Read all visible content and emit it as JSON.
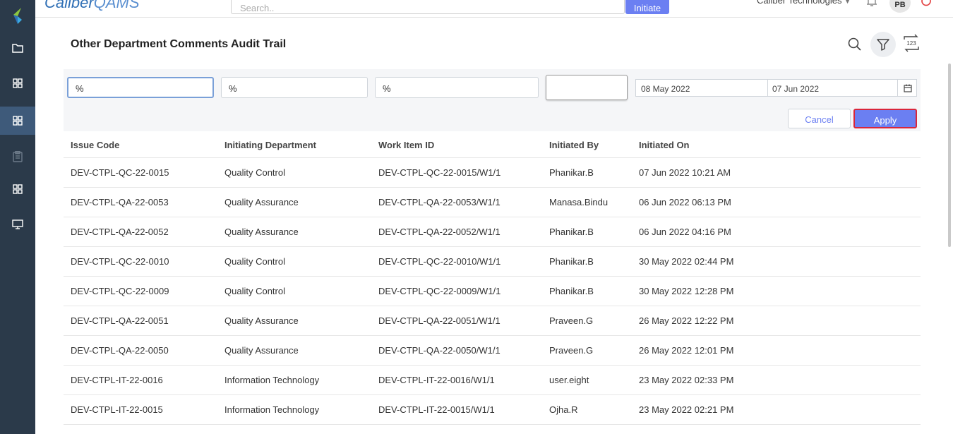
{
  "app": {
    "brand_main": "Caliber",
    "brand_sub": "QAMS",
    "search_placeholder": "Search..",
    "initiate_label": "Initiate",
    "company": "Caliber Technologies",
    "avatar_initials": "PB"
  },
  "sidebar": {
    "items": [
      {
        "icon": "folder-icon"
      },
      {
        "icon": "grid-icon"
      },
      {
        "icon": "grid-icon",
        "active": true
      },
      {
        "icon": "clipboard-icon"
      },
      {
        "icon": "grid-icon"
      },
      {
        "icon": "monitor-icon"
      }
    ]
  },
  "page": {
    "title": "Other Department Comments Audit Trail"
  },
  "filters": {
    "issue_code": "%",
    "initiating_department": "%",
    "work_item_id": "%",
    "initiated_by": "",
    "date_from": "08 May 2022",
    "date_to": "07 Jun 2022",
    "cancel_label": "Cancel",
    "apply_label": "Apply"
  },
  "table": {
    "headers": [
      "Issue Code",
      "Initiating Department",
      "Work Item ID",
      "Initiated By",
      "Initiated On"
    ],
    "rows": [
      [
        "DEV-CTPL-QC-22-0015",
        "Quality Control",
        "DEV-CTPL-QC-22-0015/W1/1",
        "Phanikar.B",
        "07 Jun 2022 10:21 AM"
      ],
      [
        "DEV-CTPL-QA-22-0053",
        "Quality Assurance",
        "DEV-CTPL-QA-22-0053/W1/1",
        "Manasa.Bindu",
        "06 Jun 2022 06:13 PM"
      ],
      [
        "DEV-CTPL-QA-22-0052",
        "Quality Assurance",
        "DEV-CTPL-QA-22-0052/W1/1",
        "Phanikar.B",
        "06 Jun 2022 04:16 PM"
      ],
      [
        "DEV-CTPL-QC-22-0010",
        "Quality Control",
        "DEV-CTPL-QC-22-0010/W1/1",
        "Phanikar.B",
        "30 May 2022 02:44 PM"
      ],
      [
        "DEV-CTPL-QC-22-0009",
        "Quality Control",
        "DEV-CTPL-QC-22-0009/W1/1",
        "Phanikar.B",
        "30 May 2022 12:28 PM"
      ],
      [
        "DEV-CTPL-QA-22-0051",
        "Quality Assurance",
        "DEV-CTPL-QA-22-0051/W1/1",
        "Praveen.G",
        "26 May 2022 12:22 PM"
      ],
      [
        "DEV-CTPL-QA-22-0050",
        "Quality Assurance",
        "DEV-CTPL-QA-22-0050/W1/1",
        "Praveen.G",
        "26 May 2022 12:01 PM"
      ],
      [
        "DEV-CTPL-IT-22-0016",
        "Information Technology",
        "DEV-CTPL-IT-22-0016/W1/1",
        "user.eight",
        "23 May 2022 02:33 PM"
      ],
      [
        "DEV-CTPL-IT-22-0015",
        "Information Technology",
        "DEV-CTPL-IT-22-0015/W1/1",
        "Ojha.R",
        "23 May 2022 02:21 PM"
      ]
    ]
  },
  "colors": {
    "sidebar_bg": "#2b3a4a",
    "accent": "#6b7ff2",
    "apply_border": "#d9263b"
  }
}
